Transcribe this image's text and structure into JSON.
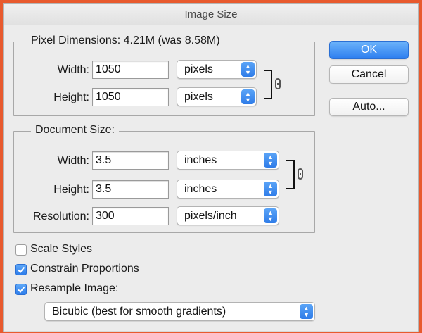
{
  "window": {
    "title": "Image Size"
  },
  "pixel_dimensions": {
    "legend": "Pixel Dimensions:  4.21M (was 8.58M)",
    "width_label": "Width:",
    "width_value": "1050",
    "width_unit": "pixels",
    "height_label": "Height:",
    "height_value": "1050",
    "height_unit": "pixels"
  },
  "document_size": {
    "legend": "Document Size:",
    "width_label": "Width:",
    "width_value": "3.5",
    "width_unit": "inches",
    "height_label": "Height:",
    "height_value": "3.5",
    "height_unit": "inches",
    "resolution_label": "Resolution:",
    "resolution_value": "300",
    "resolution_unit": "pixels/inch"
  },
  "options": {
    "scale_styles": {
      "label": "Scale Styles",
      "checked": false
    },
    "constrain_proportions": {
      "label": "Constrain Proportions",
      "checked": true
    },
    "resample_image": {
      "label": "Resample Image:",
      "checked": true
    },
    "resample_method": "Bicubic (best for smooth gradients)"
  },
  "buttons": {
    "ok": "OK",
    "cancel": "Cancel",
    "auto": "Auto..."
  },
  "icons": {
    "select_arrows": "up-down-arrows-icon",
    "link": "chain-link-icon",
    "check": "checkmark-icon"
  },
  "colors": {
    "accent": "#2d7ff0",
    "background": "#ececec",
    "frame": "#e85a2e"
  }
}
